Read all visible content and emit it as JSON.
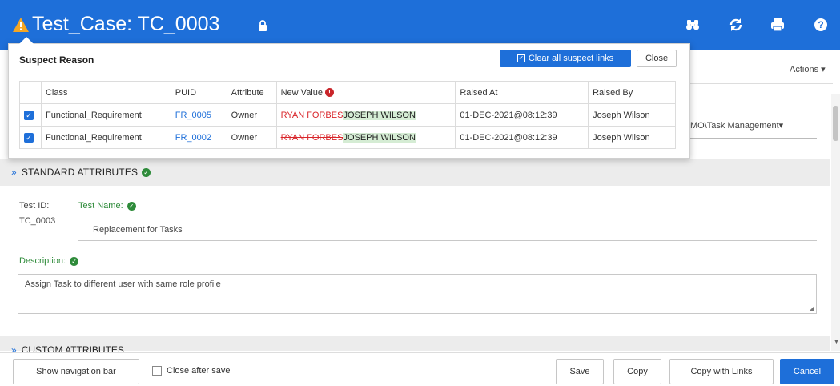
{
  "header": {
    "title": "Test_Case: TC_0003",
    "icons": [
      "warning-icon",
      "lock-icon",
      "binoculars-icon",
      "refresh-icon",
      "print-icon",
      "help-icon"
    ]
  },
  "page": {
    "actions_label": "Actions",
    "task_management": "MO\\Task Management",
    "standard_attributes": "STANDARD ATTRIBUTES",
    "custom_attributes": "CUSTOM ATTRIBUTES",
    "test_id_label": "Test ID:",
    "test_id_value": "TC_0003",
    "test_name_label": "Test Name:",
    "test_name_value": "Replacement for Tasks",
    "description_label": "Description:",
    "description_value": "Assign Task to different user with same role profile"
  },
  "popup": {
    "title": "Suspect Reason",
    "clear_label": "Clear all suspect links",
    "close_label": "Close",
    "columns": [
      "Class",
      "PUID",
      "Attribute",
      "New Value",
      "Raised At",
      "Raised By"
    ],
    "rows": [
      {
        "checked": true,
        "class": "Functional_Requirement",
        "puid": "FR_0005",
        "attribute": "Owner",
        "old_value": "RYAN FORBES",
        "new_value": "JOSEPH WILSON",
        "raised_at": "01-DEC-2021@08:12:39",
        "raised_by": "Joseph Wilson"
      },
      {
        "checked": true,
        "class": "Functional_Requirement",
        "puid": "FR_0002",
        "attribute": "Owner",
        "old_value": "RYAN FORBES",
        "new_value": "JOSEPH WILSON",
        "raised_at": "01-DEC-2021@08:12:39",
        "raised_by": "Joseph Wilson"
      }
    ]
  },
  "footer": {
    "show_nav": "Show navigation bar",
    "close_after_save": "Close after save",
    "save": "Save",
    "copy": "Copy",
    "copy_with_links": "Copy with Links",
    "cancel": "Cancel"
  },
  "colors": {
    "brand": "#1e6fd9",
    "warning": "#f5a623",
    "ok_green": "#2e8b3a",
    "strike_red": "#d9252a",
    "new_value_bg": "#d5ecd4"
  }
}
